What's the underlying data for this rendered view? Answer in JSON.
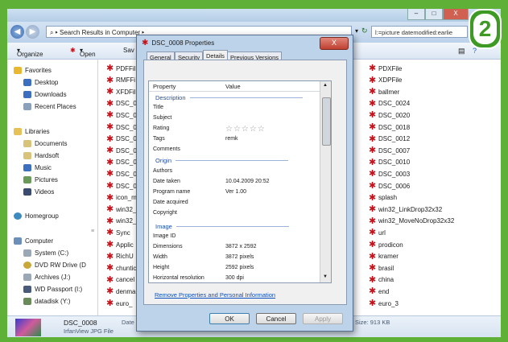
{
  "badge": "2",
  "window": {
    "address": "Search Results in Computer",
    "search_value": "l:=picture datemodified:earlie",
    "caption_min": "–",
    "caption_max": "□",
    "caption_close": "X"
  },
  "toolbar": {
    "organize": "Organize",
    "open": "Open",
    "save": "Sav"
  },
  "nav": {
    "favorites": "Favorites",
    "favorites_items": [
      "Desktop",
      "Downloads",
      "Recent Places"
    ],
    "libraries": "Libraries",
    "libraries_items": [
      "Documents",
      "Hardsoft",
      "Music",
      "Pictures",
      "Videos"
    ],
    "homegroup": "Homegroup",
    "computer": "Computer",
    "computer_items": [
      "System (C:)",
      "DVD RW Drive (D",
      "Archives (J:)",
      "WD Passport (I:)",
      "datadisk (Y:)"
    ]
  },
  "files_left": [
    "PDFFil",
    "RMFFi",
    "XFDFil",
    "DSC_0",
    "DSC_0",
    "DSC_0",
    "DSC_0",
    "DSC_0",
    "DSC_0",
    "DSC_0",
    "DSC_0",
    "icon_m",
    "win32_",
    "win32_",
    "Sync",
    "Applic",
    "RichU",
    "chuntic",
    "cancel",
    "denma",
    "euro_"
  ],
  "files_right": [
    "PDXFile",
    "XDPFile",
    "ballmer",
    "DSC_0024",
    "DSC_0020",
    "DSC_0018",
    "DSC_0012",
    "DSC_0007",
    "DSC_0010",
    "DSC_0003",
    "DSC_0006",
    "splash",
    "win32_LinkDrop32x32",
    "win32_MoveNoDrop32x32",
    "url",
    "prodicon",
    "kramer",
    "brasil",
    "china",
    "end",
    "euro_3"
  ],
  "status": {
    "filename": "DSC_0008",
    "filetype": "IrfanView JPG File",
    "date_label": "Date",
    "size": "Size: 913 KB"
  },
  "dialog": {
    "title": "DSC_0008 Properties",
    "close": "X",
    "tabs": [
      "General",
      "Security",
      "Details",
      "Previous Versions"
    ],
    "active_tab": 2,
    "col_property": "Property",
    "col_value": "Value",
    "sections": {
      "description": "Description",
      "origin": "Origin",
      "image": "Image"
    },
    "description_rows": [
      {
        "label": "Title",
        "value": ""
      },
      {
        "label": "Subject",
        "value": ""
      },
      {
        "label": "Rating",
        "value": ""
      },
      {
        "label": "Tags",
        "value": "remk"
      },
      {
        "label": "Comments",
        "value": ""
      }
    ],
    "rating_stars": "☆☆☆☆☆",
    "origin_rows": [
      {
        "label": "Authors",
        "value": ""
      },
      {
        "label": "Date taken",
        "value": "10.04.2009 20:52"
      },
      {
        "label": "Program name",
        "value": "Ver 1.00"
      },
      {
        "label": "Date acquired",
        "value": ""
      },
      {
        "label": "Copyright",
        "value": ""
      }
    ],
    "image_rows": [
      {
        "label": "Image ID",
        "value": ""
      },
      {
        "label": "Dimensions",
        "value": "3872 x 2592"
      },
      {
        "label": "Width",
        "value": "3872 pixels"
      },
      {
        "label": "Height",
        "value": "2592 pixels"
      },
      {
        "label": "Horizontal resolution",
        "value": "300 dpi"
      }
    ],
    "link": "Remove Properties and Personal Information",
    "ok": "OK",
    "cancel": "Cancel",
    "apply": "Apply"
  }
}
